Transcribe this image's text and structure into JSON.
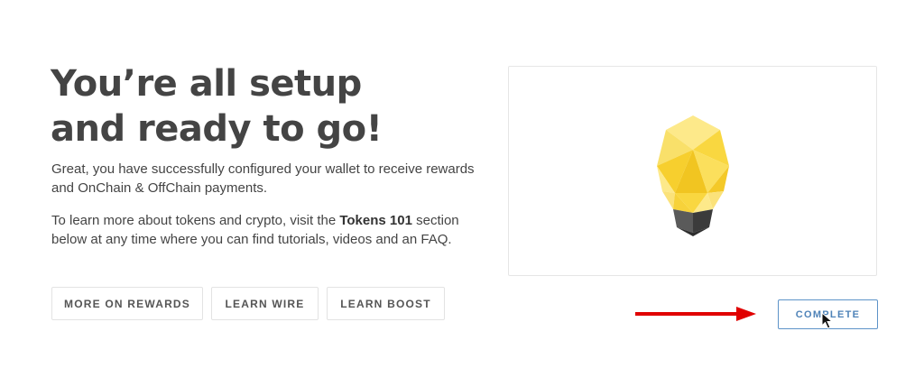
{
  "headline": "You’re all setup and ready to go!",
  "intro": "Great, you have successfully configured your wallet to receive rewards and OnChain & OffChain payments.",
  "learn_more": {
    "before": "To learn more about tokens and crypto, visit the ",
    "link": "Tokens 101",
    "after": " section below at any time where you can find tutorials, videos and an FAQ."
  },
  "buttons": {
    "more_on_rewards": "MORE ON REWARDS",
    "learn_wire": "LEARN WIRE",
    "learn_boost": "LEARN BOOST",
    "complete": "COMPLETE"
  },
  "illustration": {
    "icon": "lightbulb-icon",
    "colors": {
      "yellow_light": "#fde98a",
      "yellow_mid": "#f9d740",
      "yellow_dark": "#f1c521",
      "base_dark": "#3b3b3b",
      "base_mid": "#5a5a5a"
    }
  },
  "annotation": {
    "arrow_color": "#e00000"
  },
  "colors": {
    "text": "#444444",
    "accent_blue": "#4f83b8",
    "border": "#e3e3e3"
  }
}
